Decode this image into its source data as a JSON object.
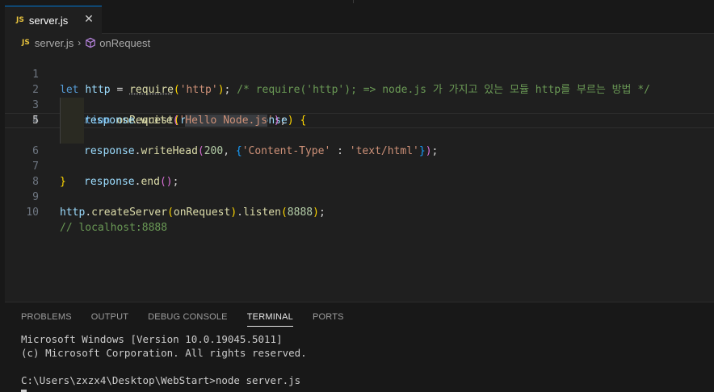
{
  "tab": {
    "icon": "JS",
    "name": "server.js",
    "close": "✕"
  },
  "breadcrumb": {
    "icon": "JS",
    "file": "server.js",
    "sep": "›",
    "symbol": "onRequest"
  },
  "editor": {
    "line_numbers": [
      "1",
      "2",
      "3",
      "4",
      "5",
      "6",
      "7",
      "8",
      "9",
      "10"
    ],
    "active_line": "5",
    "l1": {
      "let": "let",
      "http": "http",
      "eq": " = ",
      "require": "require",
      "p1": "(",
      "str": "'http'",
      "p2": ")",
      "semi": "; ",
      "comment": "/* require('http'); => node.js 가 가지고 있는 모듈 http를 부르는 방법 */"
    },
    "l3": {
      "function": "function",
      "name": "onRequest",
      "p1": "(",
      "a1": "request",
      "comma": ", ",
      "a2": "response",
      "p2": ")",
      "brace": "{"
    },
    "l4": {
      "obj": "response",
      "dot": ".",
      "method": "writeHead",
      "p1": "(",
      "num": "200",
      "comma": ", ",
      "b1": "{",
      "key": "'Content-Type'",
      "colon": " : ",
      "val": "'text/html'",
      "b2": "}",
      "p2": ")",
      "semi": ";"
    },
    "l5": {
      "obj": "response",
      "dot": ".",
      "method": "write",
      "p1": "(",
      "q1": "'",
      "text": "Hello Node.js",
      "q2": "'",
      "p2": ")",
      "semi": ";"
    },
    "l6": {
      "obj": "response",
      "dot": ".",
      "method": "end",
      "p1": "(",
      "p2": ")",
      "semi": ";"
    },
    "l7": {
      "brace": "}"
    },
    "l9": {
      "obj": "http",
      "dot1": ".",
      "m1": "createServer",
      "p1": "(",
      "arg": "onRequest",
      "p2": ")",
      "dot2": ".",
      "m2": "listen",
      "p3": "(",
      "num": "8888",
      "p4": ")",
      "semi": ";"
    },
    "l10": {
      "comment": "// localhost:8888"
    }
  },
  "panel": {
    "tabs": [
      "PROBLEMS",
      "OUTPUT",
      "DEBUG CONSOLE",
      "TERMINAL",
      "PORTS"
    ],
    "terminal_lines": [
      "Microsoft Windows [Version 10.0.19045.5011]",
      "(c) Microsoft Corporation. All rights reserved.",
      "",
      "C:\\Users\\zxzx4\\Desktop\\WebStart>node server.js"
    ]
  },
  "colors": {
    "accent": "#0078d4",
    "js_icon": "#e8c33d",
    "symbol_icon": "#b180d7"
  }
}
